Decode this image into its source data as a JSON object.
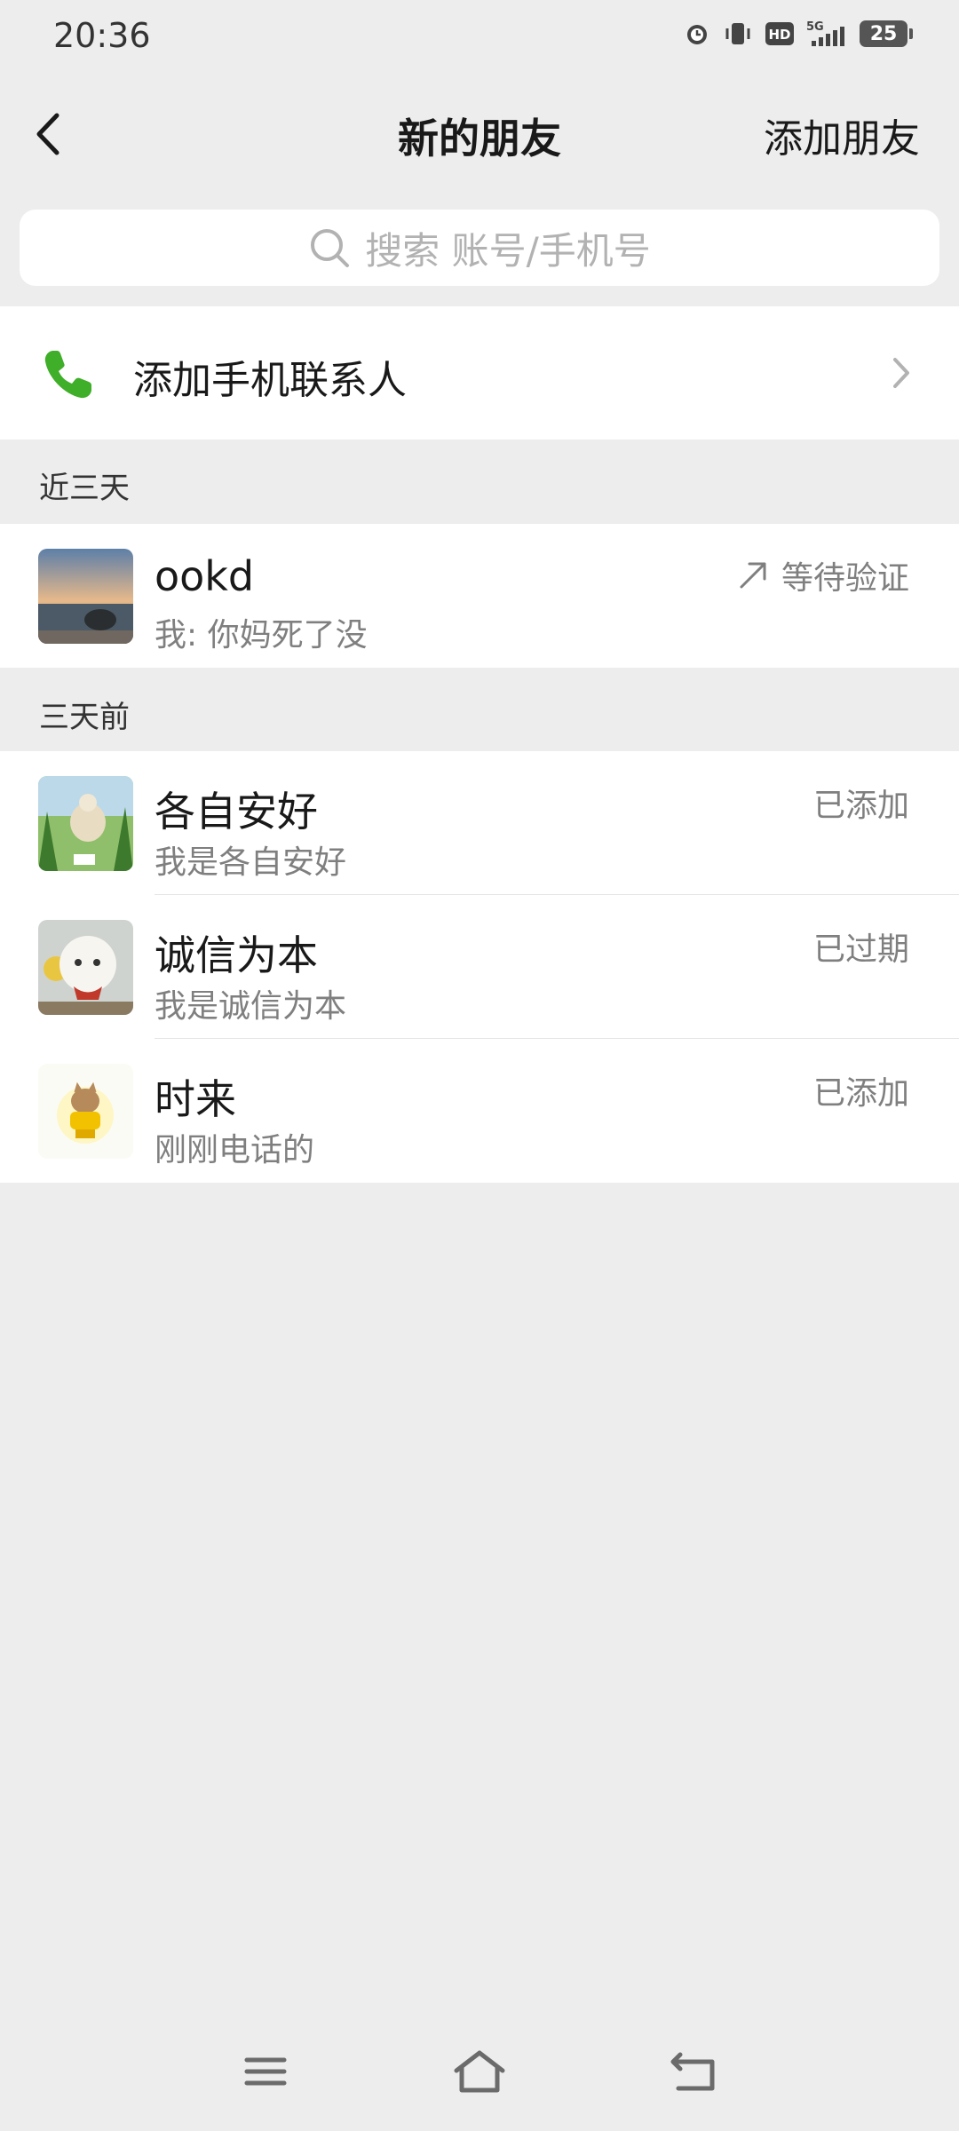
{
  "status_bar": {
    "time": "20:36",
    "icons": [
      "alarm-icon",
      "vibrate-icon",
      "hd-icon",
      "signal-5g-icon"
    ],
    "battery": "25"
  },
  "nav": {
    "title": "新的朋友",
    "action": "添加朋友"
  },
  "search": {
    "placeholder": "搜索 账号/手机号"
  },
  "phone_contacts": {
    "label": "添加手机联系人"
  },
  "sections": [
    {
      "header": "近三天",
      "items": [
        {
          "name": "ookd",
          "message": "我: 你妈死了没",
          "status": "等待验证",
          "status_icon": "arrow-up-right-icon"
        }
      ]
    },
    {
      "header": "三天前",
      "items": [
        {
          "name": "各自安好",
          "message": "我是各自安好",
          "status": "已添加"
        },
        {
          "name": "诚信为本",
          "message": "我是诚信为本",
          "status": "已过期"
        },
        {
          "name": "时来",
          "message": "刚刚电话的",
          "status": "已添加"
        }
      ]
    }
  ],
  "colors": {
    "background": "#EDEDED",
    "accent_green": "#3FAE29",
    "secondary_text": "#7F7F7F"
  }
}
